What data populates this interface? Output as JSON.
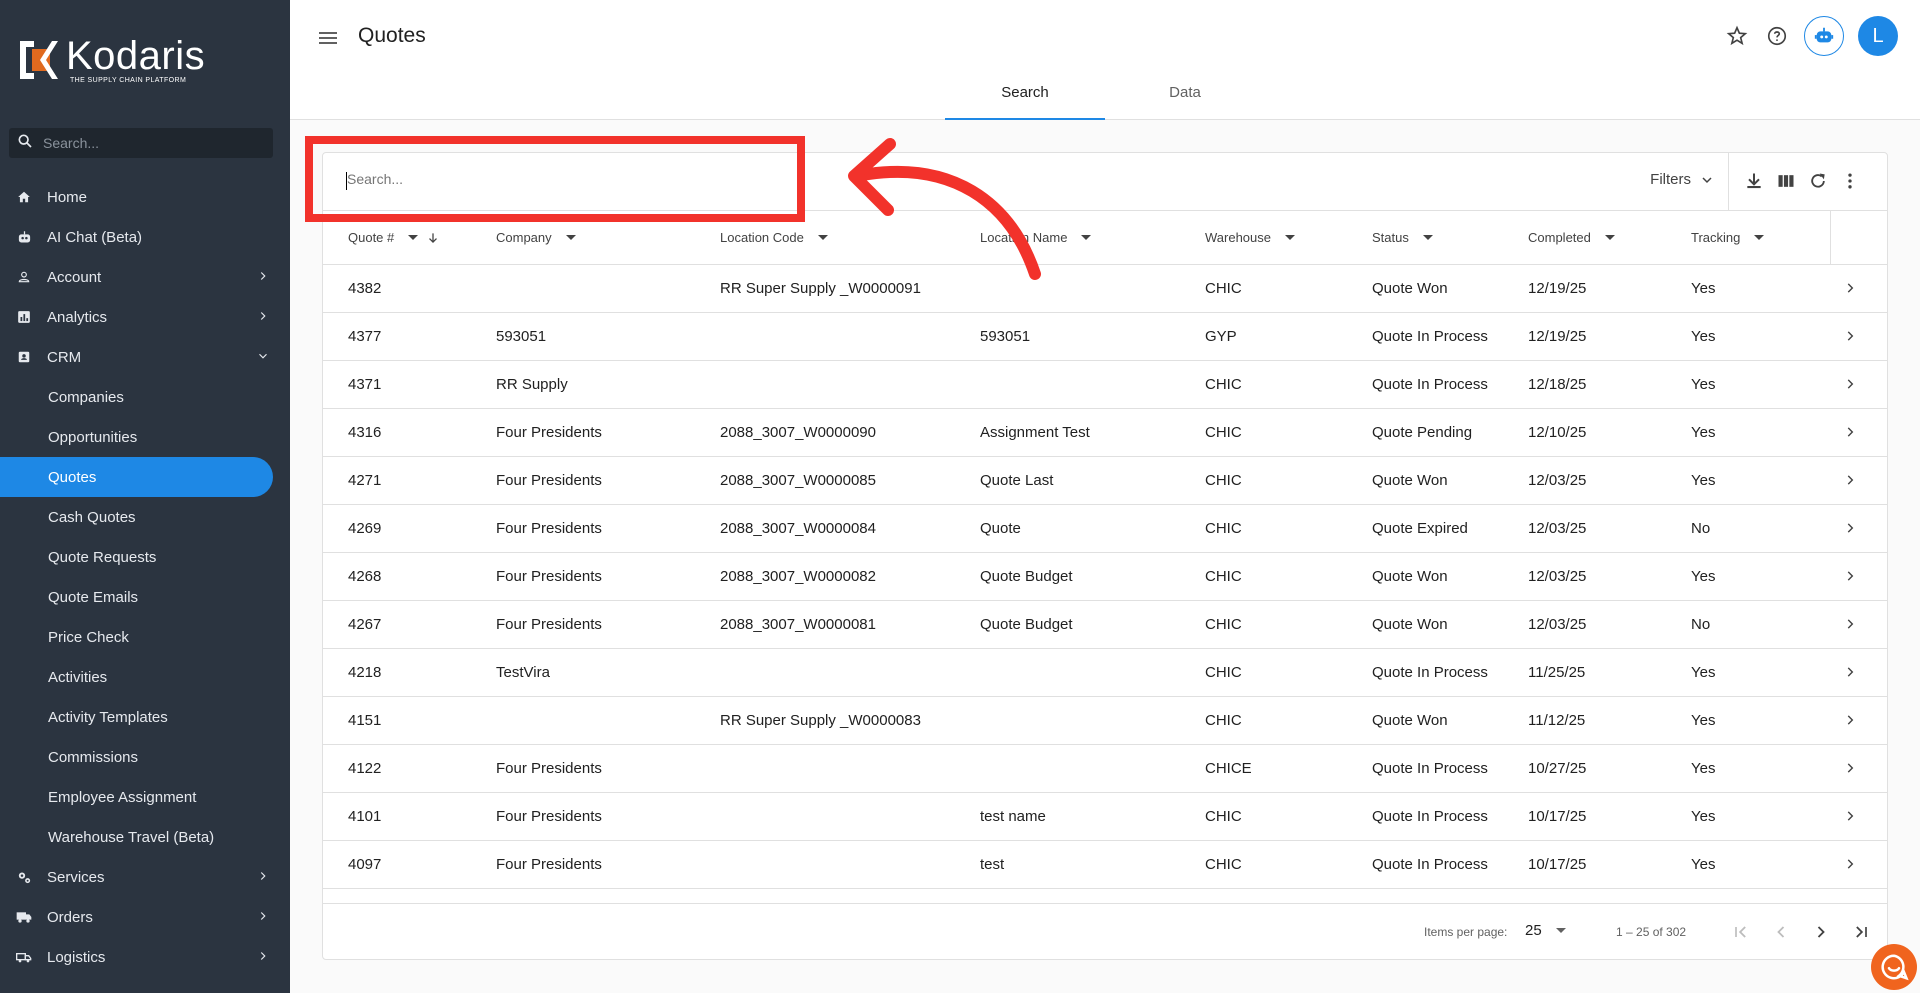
{
  "brand": {
    "name": "Kodaris",
    "tagline": "THE SUPPLY CHAIN PLATFORM"
  },
  "sidebar": {
    "search_placeholder": "Search...",
    "items": [
      {
        "label": "Home",
        "icon": "home-icon"
      },
      {
        "label": "AI Chat (Beta)",
        "icon": "robot-icon"
      },
      {
        "label": "Account",
        "icon": "person-icon",
        "chevron": "right"
      },
      {
        "label": "Analytics",
        "icon": "analytics-icon",
        "chevron": "right"
      },
      {
        "label": "CRM",
        "icon": "contacts-icon",
        "chevron": "down"
      },
      {
        "label": "Companies"
      },
      {
        "label": "Opportunities"
      },
      {
        "label": "Quotes",
        "active": true
      },
      {
        "label": "Cash Quotes"
      },
      {
        "label": "Quote Requests"
      },
      {
        "label": "Quote Emails"
      },
      {
        "label": "Price Check"
      },
      {
        "label": "Activities"
      },
      {
        "label": "Activity Templates"
      },
      {
        "label": "Commissions"
      },
      {
        "label": "Employee Assignment"
      },
      {
        "label": "Warehouse Travel (Beta)"
      },
      {
        "label": "Services",
        "icon": "gears-icon",
        "chevron": "right"
      },
      {
        "label": "Orders",
        "icon": "truck-icon",
        "chevron": "right"
      },
      {
        "label": "Logistics",
        "icon": "shipping-icon",
        "chevron": "right"
      }
    ]
  },
  "header": {
    "title": "Quotes",
    "tabs": [
      {
        "label": "Search",
        "active": true
      },
      {
        "label": "Data"
      }
    ],
    "avatar_initial": "L",
    "accent_color": "#1e88e5"
  },
  "toolbar": {
    "search_placeholder": "Search...",
    "filters_label": "Filters"
  },
  "table": {
    "columns": [
      "Quote #",
      "Company",
      "Location Code",
      "Location Name",
      "Warehouse",
      "Status",
      "Completed",
      "Tracking"
    ],
    "rows": [
      [
        "4382",
        "",
        "RR Super Supply _W0000091",
        "",
        "CHIC",
        "Quote Won",
        "12/19/25",
        "Yes"
      ],
      [
        "4377",
        "593051",
        "",
        "593051",
        "GYP",
        "Quote In Process",
        "12/19/25",
        "Yes"
      ],
      [
        "4371",
        "RR Supply",
        "",
        "",
        "CHIC",
        "Quote In Process",
        "12/18/25",
        "Yes"
      ],
      [
        "4316",
        "Four Presidents",
        "2088_3007_W0000090",
        "Assignment Test",
        "CHIC",
        "Quote Pending",
        "12/10/25",
        "Yes"
      ],
      [
        "4271",
        "Four Presidents",
        "2088_3007_W0000085",
        "Quote Last",
        "CHIC",
        "Quote Won",
        "12/03/25",
        "Yes"
      ],
      [
        "4269",
        "Four Presidents",
        "2088_3007_W0000084",
        "Quote",
        "CHIC",
        "Quote Expired",
        "12/03/25",
        "No"
      ],
      [
        "4268",
        "Four Presidents",
        "2088_3007_W0000082",
        "Quote Budget",
        "CHIC",
        "Quote Won",
        "12/03/25",
        "Yes"
      ],
      [
        "4267",
        "Four Presidents",
        "2088_3007_W0000081",
        "Quote Budget",
        "CHIC",
        "Quote Won",
        "12/03/25",
        "No"
      ],
      [
        "4218",
        "TestVira",
        "",
        "",
        "CHIC",
        "Quote In Process",
        "11/25/25",
        "Yes"
      ],
      [
        "4151",
        "",
        "RR Super Supply _W0000083",
        "",
        "CHIC",
        "Quote Won",
        "11/12/25",
        "Yes"
      ],
      [
        "4122",
        "Four Presidents",
        "",
        "",
        "CHICE",
        "Quote In Process",
        "10/27/25",
        "Yes"
      ],
      [
        "4101",
        "Four Presidents",
        "",
        "test name",
        "CHIC",
        "Quote In Process",
        "10/17/25",
        "Yes"
      ],
      [
        "4097",
        "Four Presidents",
        "",
        "test",
        "CHIC",
        "Quote In Process",
        "10/17/25",
        "Yes"
      ]
    ]
  },
  "pagination": {
    "items_per_page_label": "Items per page:",
    "items_per_page": "25",
    "range": "1 – 25 of 302"
  },
  "annotation": {
    "color": "#f2322b"
  }
}
